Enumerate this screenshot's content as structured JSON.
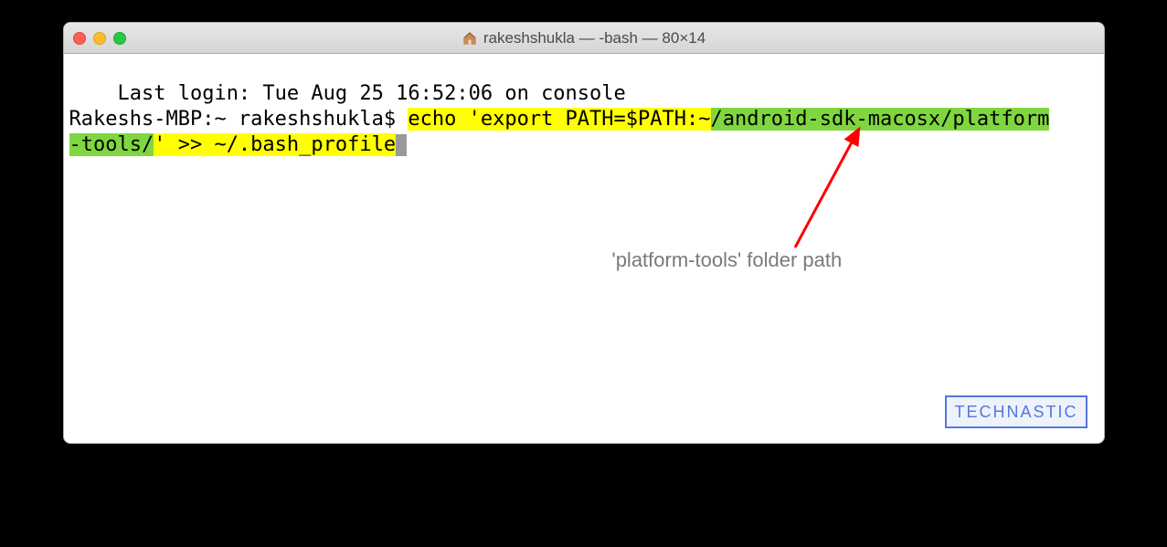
{
  "window": {
    "title": "rakeshshukla — -bash — 80×14"
  },
  "terminal": {
    "last_login": "Last login: Tue Aug 25 16:52:06 on console",
    "prompt": "Rakeshs-MBP:~ rakeshshukla$ ",
    "cmd_part1": "echo 'export PATH=$PATH:~",
    "cmd_part2_green": "/android-sdk-macosx/platform",
    "cmd_part3_green": "-tools/",
    "cmd_part4": "' >> ~/.bash_profile"
  },
  "annotation": {
    "label": "'platform-tools' folder path"
  },
  "watermark": "TECHNASTIC",
  "colors": {
    "highlight_yellow": "#ffff00",
    "highlight_green": "#7fd63f",
    "arrow": "#ff0000"
  }
}
